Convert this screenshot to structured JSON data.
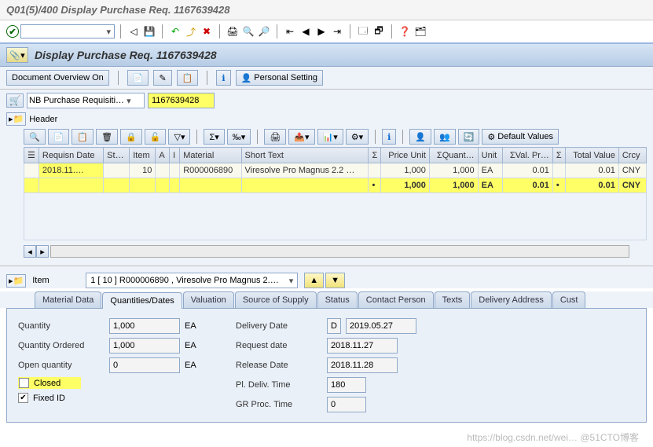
{
  "window": {
    "title": "Q01(5)/400 Display Purchase Req. 1167639428"
  },
  "page": {
    "title": "Display Purchase Req. 1167639428"
  },
  "subtoolbar": {
    "doc_overview": "Document Overview On",
    "personal_setting": "Personal Setting"
  },
  "req": {
    "doctype": "NB Purchase Requisiti…",
    "number": "1167639428",
    "header_label": "Header"
  },
  "gridtoolbar": {
    "default_values": "Default Values"
  },
  "grid": {
    "cols": {
      "requisn_date": "Requisn Date",
      "st": "St…",
      "item": "Item",
      "a": "A",
      "i": "I",
      "material": "Material",
      "short_text": "Short Text",
      "sigma1": "Σ",
      "price_unit": "Price Unit",
      "quant": "ΣQuant…",
      "unit": "Unit",
      "val_pr": "ΣVal. Pr…",
      "sigma2": "Σ",
      "total_value": "Total Value",
      "crcy": "Crcy"
    },
    "row": {
      "requisn_date": "2018.11.…",
      "st": "",
      "item": "10",
      "a": "",
      "i": "",
      "material": "R000006890",
      "short_text": "Viresolve Pro Magnus 2.2 …",
      "price_unit": "1,000",
      "quant": "1,000",
      "unit": "EA",
      "val_pr": "0.01",
      "total_value": "0.01",
      "crcy": "CNY"
    },
    "total": {
      "price_unit": "1,000",
      "quant": "1,000",
      "unit": "EA",
      "val_pr": "0.01",
      "total_value": "0.01",
      "crcy": "CNY"
    }
  },
  "item": {
    "label": "Item",
    "selected": "1 [ 10 ] R000006890 , Viresolve Pro Magnus 2.…"
  },
  "tabs": {
    "material_data": "Material Data",
    "quantities_dates": "Quantities/Dates",
    "valuation": "Valuation",
    "source_of_supply": "Source of Supply",
    "status": "Status",
    "contact_person": "Contact Person",
    "texts": "Texts",
    "delivery_address": "Delivery Address",
    "cust": "Cust"
  },
  "form": {
    "left": {
      "quantity_lbl": "Quantity",
      "quantity_val": "1,000",
      "quantity_unit": "EA",
      "qty_ord_lbl": "Quantity Ordered",
      "qty_ord_val": "1,000",
      "qty_ord_unit": "EA",
      "open_qty_lbl": "Open quantity",
      "open_qty_val": "0",
      "open_qty_unit": "EA",
      "closed_lbl": "Closed",
      "fixed_id_lbl": "Fixed ID"
    },
    "right": {
      "deliv_date_lbl": "Delivery Date",
      "deliv_date_cat": "D",
      "deliv_date_val": "2019.05.27",
      "req_date_lbl": "Request date",
      "req_date_val": "2018.11.27",
      "rel_date_lbl": "Release Date",
      "rel_date_val": "2018.11.28",
      "pl_deliv_lbl": "Pl. Deliv. Time",
      "pl_deliv_val": "180",
      "gr_proc_lbl": "GR Proc. Time",
      "gr_proc_val": "0"
    }
  },
  "watermark": "https://blog.csdn.net/wei… @51CTO博客"
}
